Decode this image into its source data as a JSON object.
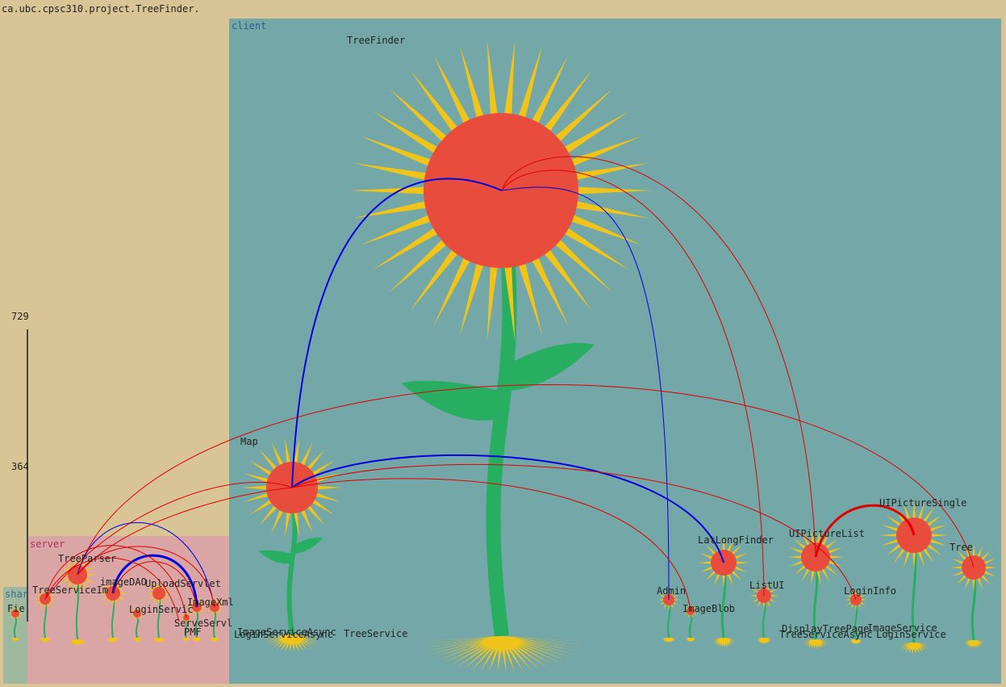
{
  "title": "ca.ubc.cpsc310.project.TreeFinder.",
  "scale": {
    "top": "729",
    "mid": "364"
  },
  "packages": {
    "client": {
      "label": "client",
      "color": "#74a7a7"
    },
    "server": {
      "label": "server",
      "color": "#d9a5a5"
    },
    "shared": {
      "label": "shar",
      "color": "#9fb8a0"
    }
  },
  "colors": {
    "petal": "#f0c419",
    "center": "#e84c3d",
    "stem": "#27ae60",
    "dep_red": "#e00000",
    "dep_blue": "#0000e0"
  },
  "classes": {
    "treefinder": "TreeFinder",
    "map": "Map",
    "latlongfinder": "LatLongFinder",
    "uipicturelist": "UIPictureList",
    "uipicturesingle": "UIPictureSingle",
    "tree": "Tree",
    "listui": "ListUI",
    "admin": "Admin",
    "imageblob": "ImageBlob",
    "logininfo": "LoginInfo",
    "imageserviceasync": "ImageServiceAsync",
    "loginserviceasync": "LoginServiceAsync",
    "treeservice": "TreeService",
    "displaytreepage": "DisplayTreePage",
    "treeserviceasync": "TreeServiceAsync",
    "imageservice": "ImageService",
    "loginservice": "LoginService",
    "treeparser": "TreeParser",
    "treeserviceimpl": "TreeServiceIm",
    "imagedao": "imageDAO",
    "uploadservlet": "UploadServlet",
    "loginserviceimpl": "LoginServic",
    "imagexml": "ImageXml",
    "serveservlet": "ServeServl",
    "pmf": "PMF",
    "fie": "Fie"
  }
}
